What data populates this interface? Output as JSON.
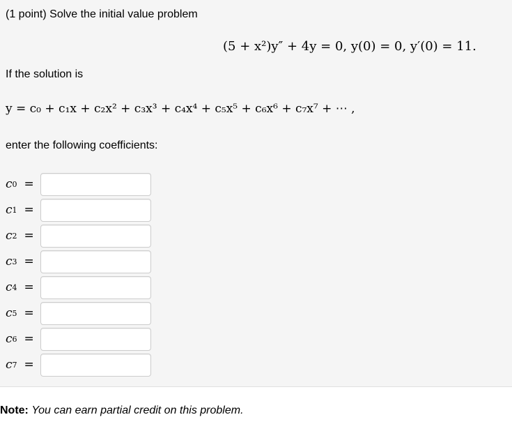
{
  "problem": {
    "intro": "(1 point) Solve the initial value problem",
    "ivp": "(5 + x²)y″ + 4y = 0, y(0) = 0, y′(0) = 11.",
    "if_solution": "If the solution is",
    "series": "y = c₀ + c₁x + c₂x² + c₃x³ + c₄x⁴ + c₅x⁵ + c₆x⁶ + c₇x⁷ + ⋯ ,",
    "enter_prompt": "enter the following coefficients:",
    "coefficients": [
      {
        "label": "c",
        "sub": "0",
        "value": ""
      },
      {
        "label": "c",
        "sub": "1",
        "value": ""
      },
      {
        "label": "c",
        "sub": "2",
        "value": ""
      },
      {
        "label": "c",
        "sub": "3",
        "value": ""
      },
      {
        "label": "c",
        "sub": "4",
        "value": ""
      },
      {
        "label": "c",
        "sub": "5",
        "value": ""
      },
      {
        "label": "c",
        "sub": "6",
        "value": ""
      },
      {
        "label": "c",
        "sub": "7",
        "value": ""
      }
    ],
    "equals": "="
  },
  "note": {
    "label": "Note:",
    "text": "You can earn partial credit on this problem."
  }
}
